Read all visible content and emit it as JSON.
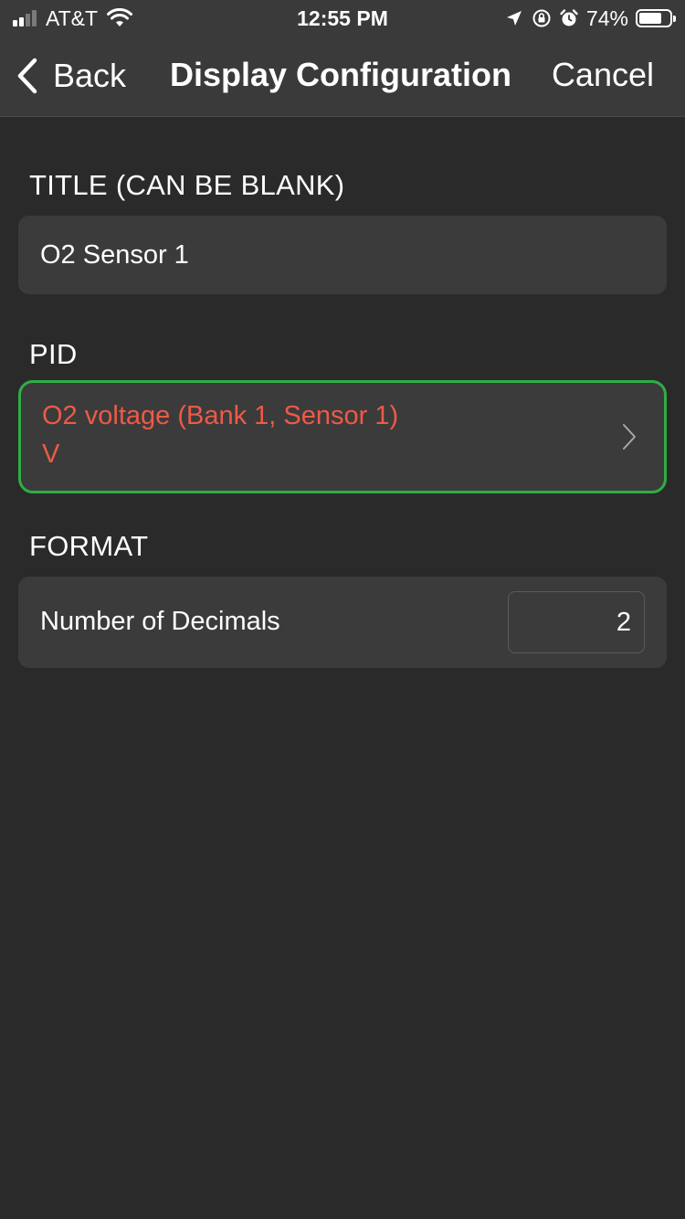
{
  "status_bar": {
    "carrier": "AT&T",
    "time": "12:55 PM",
    "battery_percent": "74%",
    "battery_level": 0.74,
    "signal_bars_filled": 2,
    "signal_bars_total": 4,
    "icons": [
      "signal-icon",
      "wifi-icon",
      "location-arrow-icon",
      "orientation-lock-icon",
      "alarm-icon",
      "battery-icon"
    ]
  },
  "nav": {
    "back_label": "Back",
    "title": "Display Configuration",
    "cancel_label": "Cancel",
    "back_icon": "chevron-left-icon"
  },
  "sections": {
    "title": {
      "header": "TITLE (CAN BE BLANK)",
      "value": "O2 Sensor 1"
    },
    "pid": {
      "header": "PID",
      "name": "O2 voltage (Bank 1, Sensor 1)",
      "unit": "V",
      "text_color": "#ee5a47",
      "border_color": "#2fae44",
      "icon": "chevron-right-icon"
    },
    "format": {
      "header": "FORMAT",
      "decimals_label": "Number of Decimals",
      "decimals_value": "2"
    }
  },
  "colors": {
    "background": "#2a2a2a",
    "bar_background": "#3a3a3a",
    "card_background": "#3b3b3b"
  }
}
